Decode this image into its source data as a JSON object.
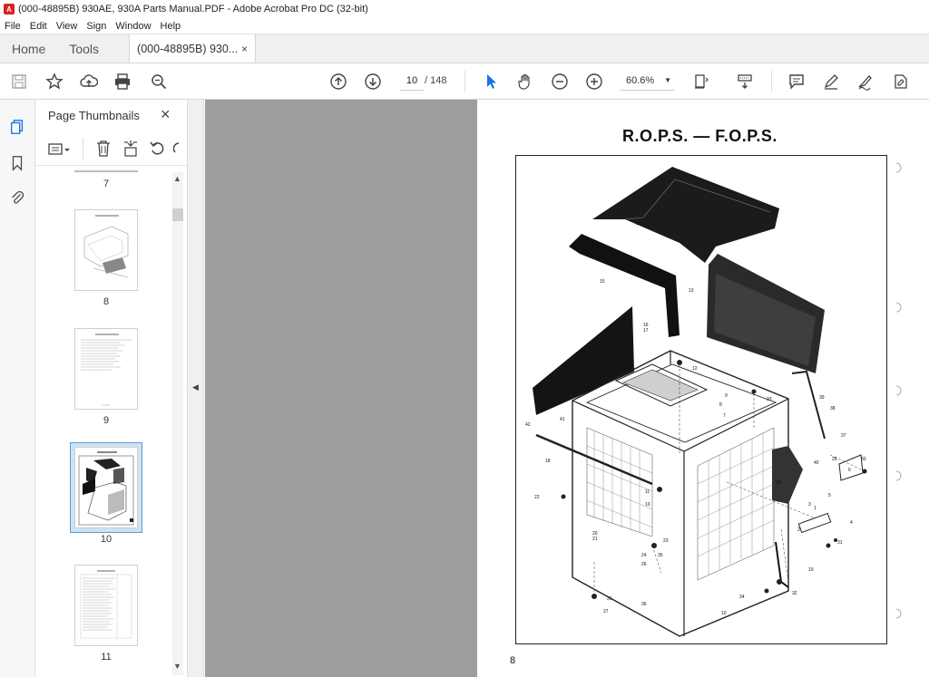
{
  "window": {
    "title": "(000-48895B) 930AE, 930A Parts Manual.PDF - Adobe Acrobat Pro DC (32-bit)"
  },
  "menu": [
    "File",
    "Edit",
    "View",
    "Sign",
    "Window",
    "Help"
  ],
  "tabs": {
    "home": "Home",
    "tools": "Tools",
    "document": "(000-48895B) 930...",
    "close": "×"
  },
  "toolbar": {
    "current_page": "10",
    "page_total": "/  148",
    "zoom": "60.6%"
  },
  "thumbnails": {
    "header": "Page Thumbnails",
    "close": "×",
    "items": [
      {
        "label": "7"
      },
      {
        "label": "8"
      },
      {
        "label": "9"
      },
      {
        "label": "10",
        "selected": true
      },
      {
        "label": "11"
      }
    ]
  },
  "document": {
    "page_title": "R.O.P.S. — F.O.P.S.",
    "page_number": "8",
    "part_callouts": [
      "14",
      "15",
      "13",
      "16",
      "17",
      "12",
      "9",
      "8",
      "7",
      "33",
      "39",
      "38",
      "37",
      "42",
      "41",
      "18",
      "40",
      "6",
      "28",
      "29",
      "30",
      "5",
      "3",
      "4",
      "2",
      "1",
      "31",
      "19",
      "32",
      "22",
      "11",
      "10",
      "20",
      "21",
      "23",
      "24",
      "26",
      "25",
      "27",
      "35",
      "34",
      "36",
      "10"
    ]
  },
  "colors": {
    "canvas_bg": "#9d9d9d",
    "accent": "#1473e6",
    "adobe_red": "#d8231f"
  }
}
